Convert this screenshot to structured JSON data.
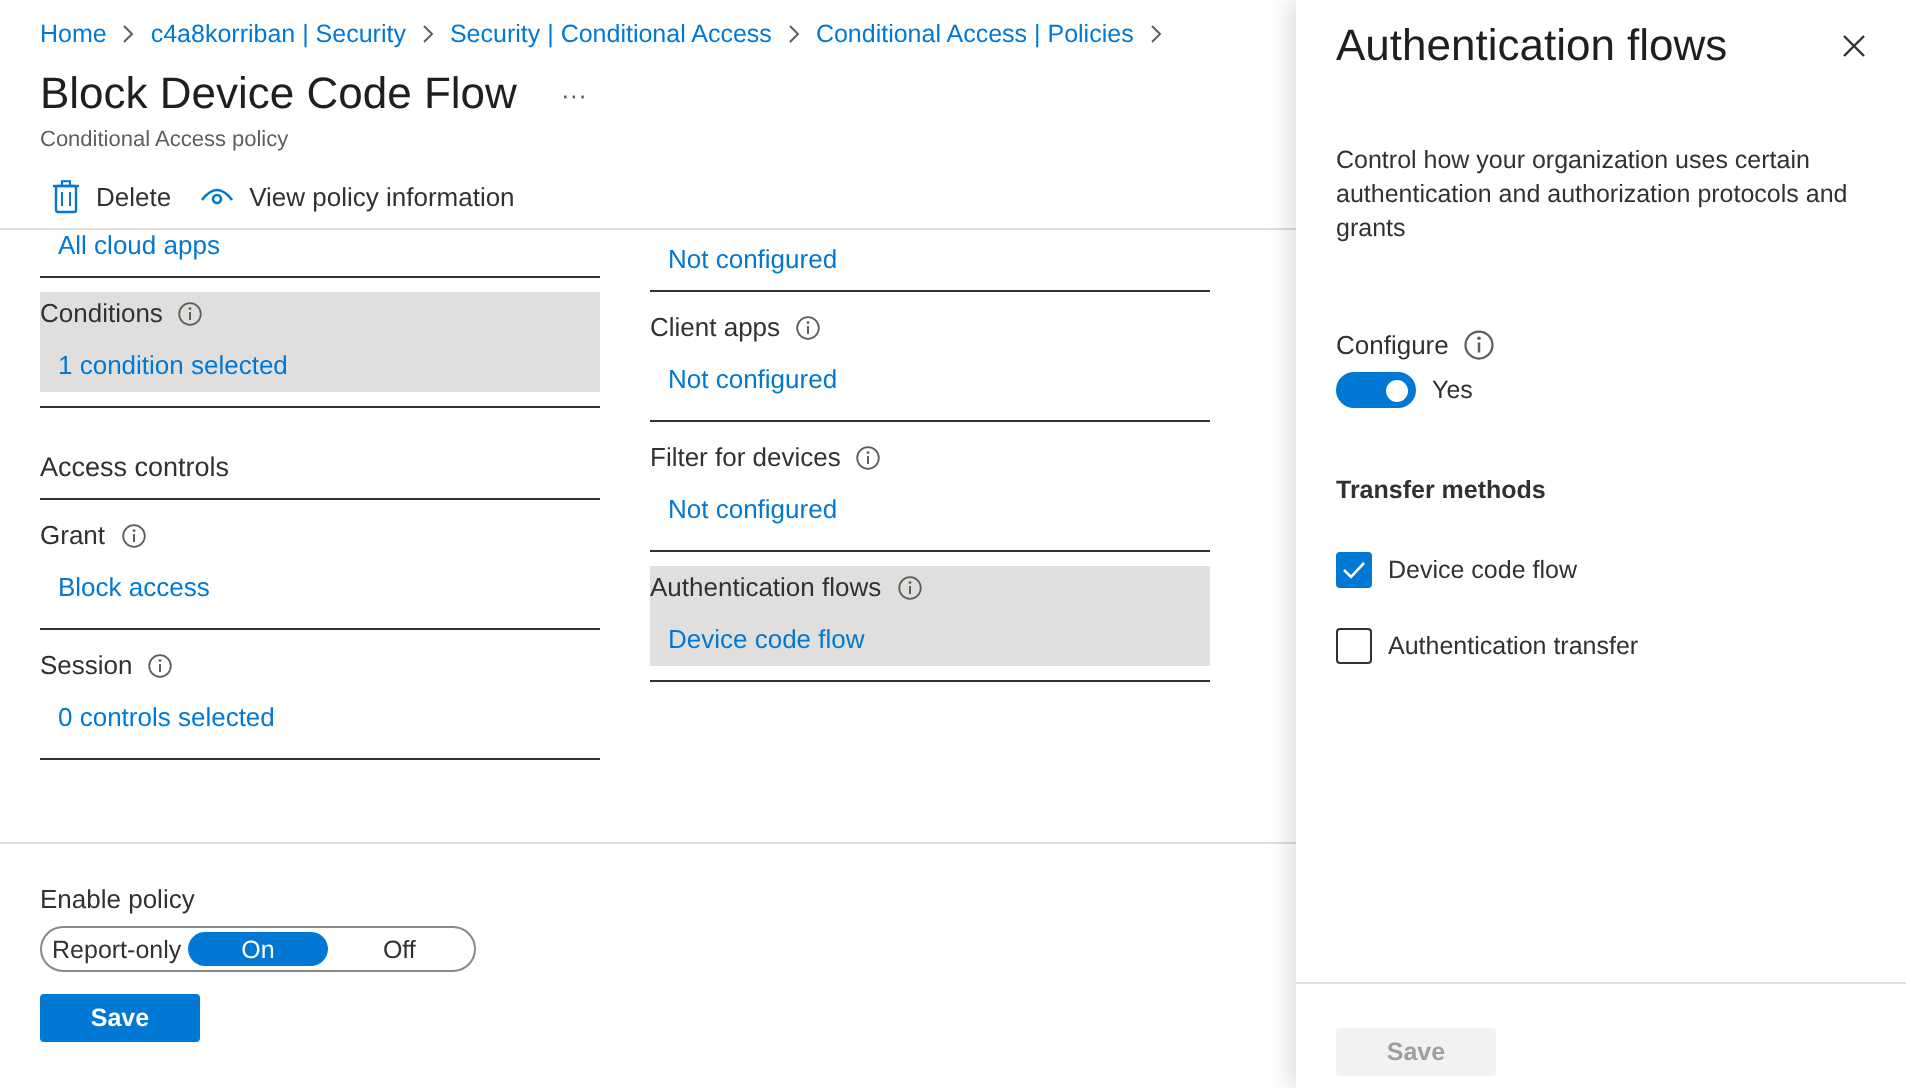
{
  "breadcrumb": [
    "Home",
    "c4a8korriban | Security",
    "Security | Conditional Access",
    "Conditional Access | Policies"
  ],
  "title": "Block Device Code Flow",
  "more": "···",
  "subtitle": "Conditional Access policy",
  "toolbar": [
    {
      "kind": "delete",
      "label": "Delete"
    },
    {
      "kind": "view",
      "label": "View policy information"
    }
  ],
  "left_column": [
    {
      "kind": "value",
      "value": "All cloud apps",
      "highlighted": false
    },
    {
      "kind": "setting",
      "label": "Conditions",
      "value": "1 condition selected",
      "highlighted": true
    },
    {
      "kind": "heading",
      "label": "Access controls"
    },
    {
      "kind": "setting",
      "label": "Grant",
      "value": "Block access",
      "highlighted": false
    },
    {
      "kind": "setting",
      "label": "Session",
      "value": "0 controls selected",
      "highlighted": false
    }
  ],
  "right_column": [
    {
      "kind": "value",
      "value": "Not configured",
      "highlighted": false
    },
    {
      "kind": "setting",
      "label": "Client apps",
      "value": "Not configured",
      "highlighted": false
    },
    {
      "kind": "setting",
      "label": "Filter for devices",
      "value": "Not configured",
      "highlighted": false
    },
    {
      "kind": "setting",
      "label": "Authentication flows",
      "value": "Device code flow",
      "highlighted": true
    }
  ],
  "enable_policy": {
    "label": "Enable policy",
    "options": [
      {
        "label": "Report-only",
        "selected": false
      },
      {
        "label": "On",
        "selected": true
      },
      {
        "label": "Off",
        "selected": false
      }
    ]
  },
  "save_button": {
    "label": "Save",
    "disabled": false
  },
  "panel": {
    "title": "Authentication flows",
    "description": "Control how your organization uses certain authentication and authorization protocols and grants",
    "configure": {
      "label": "Configure",
      "on": true,
      "state_label": "Yes"
    },
    "section_title": "Transfer methods",
    "methods": [
      {
        "label": "Device code flow",
        "checked": true
      },
      {
        "label": "Authentication transfer",
        "checked": false
      }
    ],
    "save_button": {
      "label": "Save",
      "disabled": true
    }
  }
}
